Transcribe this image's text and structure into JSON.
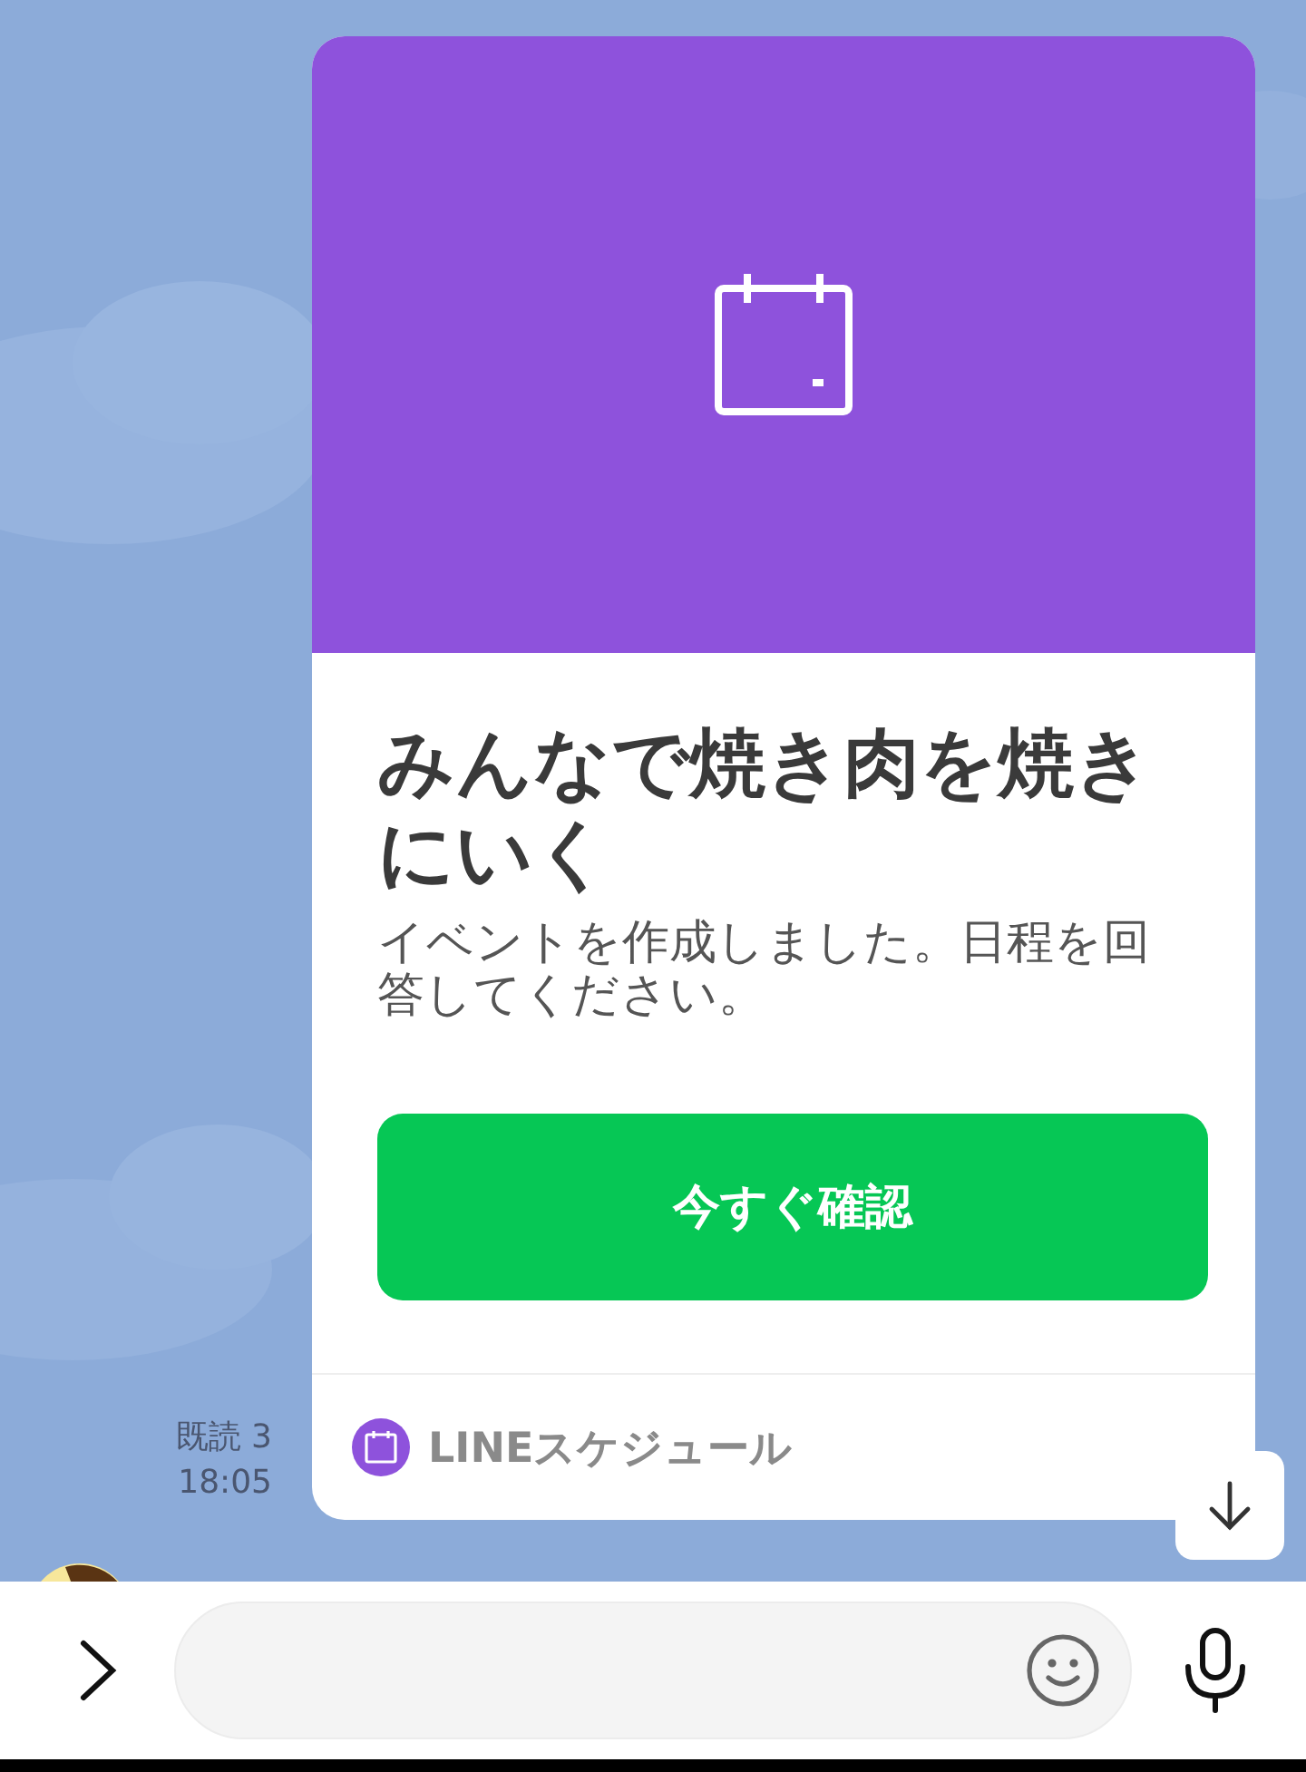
{
  "message": {
    "read_receipt": "既読 3",
    "time": "18:05"
  },
  "card": {
    "title": "みんなで焼き肉を焼きにいく",
    "description": "イベントを作成しました。日程を回答してください。",
    "button": "今すぐ確認",
    "footer": "LINEスケジュール"
  }
}
